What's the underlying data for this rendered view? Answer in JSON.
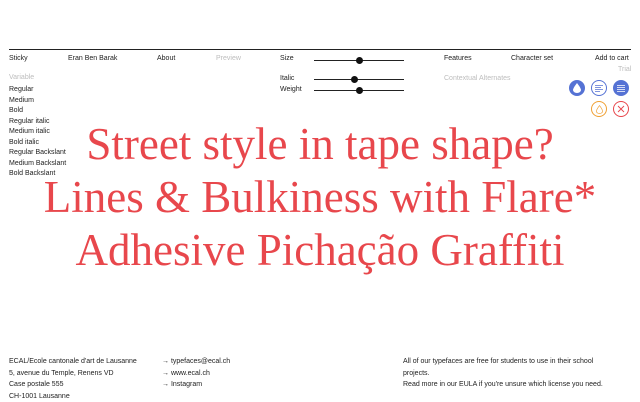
{
  "nav": {
    "sticky": "Sticky",
    "designer": "Eran Ben Barak",
    "about": "About",
    "preview": "Preview",
    "features": "Features",
    "character_set": "Character set",
    "add_to_cart": "Add to cart",
    "trial": "Trial"
  },
  "controls": {
    "size_label": "Size",
    "size_value": 0.5,
    "italic_label": "Italic",
    "italic_value": 0.4,
    "weight_label": "Weight",
    "weight_value": 0.5,
    "contextual": "Contextual Alternates"
  },
  "styles": {
    "header": "Variable",
    "items": [
      "Regular",
      "Medium",
      "Bold",
      "Regular italic",
      "Medium italic",
      "Bold italic",
      "Regular Backslant",
      "Medium Backslant",
      "Bold Backslant"
    ]
  },
  "preview_text": {
    "line1": "Street style in tape shape?",
    "line2": "Lines & Bulkiness with Flare*",
    "line3": "Adhesive Pichação Graffiti"
  },
  "colors": {
    "preview": "#e8474c",
    "blue": "#5572d4",
    "orange": "#f0a033",
    "red": "#e8474c"
  },
  "icons": [
    "droplet-icon",
    "align-left-icon",
    "align-justify-icon",
    "drop-outline-icon",
    "close-icon"
  ],
  "footer": {
    "address": [
      "ECAL/Ecole cantonale d'art de Lausanne",
      "5, avenue du Temple, Renens VD",
      "Case postale 555",
      "CH-1001 Lausanne"
    ],
    "links": [
      "→ typefaces@ecal.ch",
      "→ www.ecal.ch",
      "→ Instagram"
    ],
    "license_line1": "All of our typefaces are free for students to use in their school",
    "license_line2": "projects.",
    "license_line3": "Read more in our EULA if you're unsure which license you need."
  }
}
